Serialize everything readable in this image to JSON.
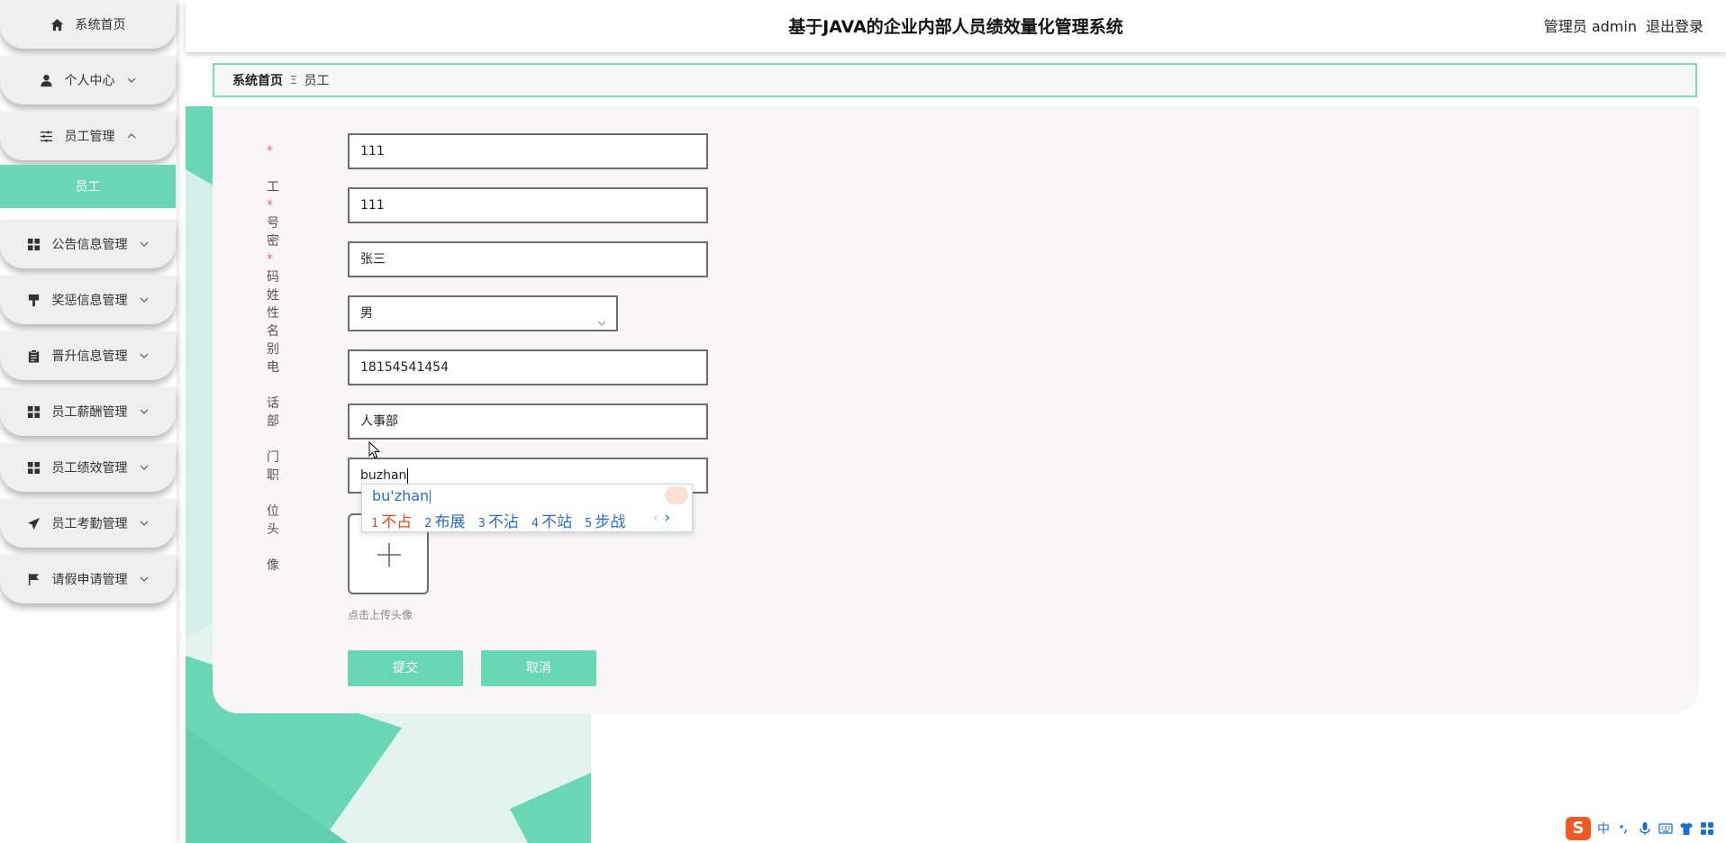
{
  "sidebar": {
    "items": [
      {
        "label": "系统首页",
        "icon": "home-icon",
        "chevron": ""
      },
      {
        "label": "个人中心",
        "icon": "user-icon",
        "chevron": "down"
      },
      {
        "label": "员工管理",
        "icon": "sliders-icon",
        "chevron": "up"
      },
      {
        "label": "公告信息管理",
        "icon": "grid-icon",
        "chevron": "down"
      },
      {
        "label": "奖惩信息管理",
        "icon": "brush-icon",
        "chevron": "down"
      },
      {
        "label": "晋升信息管理",
        "icon": "clipboard-icon",
        "chevron": "down"
      },
      {
        "label": "员工薪酬管理",
        "icon": "grid-icon",
        "chevron": "down"
      },
      {
        "label": "员工绩效管理",
        "icon": "grid-icon",
        "chevron": "down"
      },
      {
        "label": "员工考勤管理",
        "icon": "send-icon",
        "chevron": "down"
      },
      {
        "label": "请假申请管理",
        "icon": "flag-icon",
        "chevron": "down"
      }
    ],
    "submenu": {
      "label": "员工"
    }
  },
  "header": {
    "title": "基于JAVA的企业内部人员绩效量化管理系统",
    "role": "管理员 admin",
    "logout": "退出登录"
  },
  "breadcrumb": {
    "home": "系统首页",
    "separator": "Ξ",
    "current": "员工"
  },
  "form": {
    "fields": [
      {
        "label": "工号",
        "value": "111",
        "required": "*"
      },
      {
        "label": "密码",
        "value": "111",
        "required": "*"
      },
      {
        "label": "姓名",
        "value": "张三",
        "required": "*"
      },
      {
        "label": "性别",
        "value": "男",
        "required": ""
      },
      {
        "label": "电话",
        "value": "18154541454",
        "required": ""
      },
      {
        "label": "部门",
        "value": "人事部",
        "required": ""
      },
      {
        "label": "职位",
        "value": "buzhan",
        "required": ""
      }
    ],
    "avatar": {
      "label": "头像",
      "tip": "点击上传头像"
    },
    "submit": "提交",
    "cancel": "取消"
  },
  "ime": {
    "pinyin": "bu'zhan",
    "candidates": [
      {
        "num": "1",
        "text": "不占"
      },
      {
        "num": "2",
        "text": "布展"
      },
      {
        "num": "3",
        "text": "不沾"
      },
      {
        "num": "4",
        "text": "不站"
      },
      {
        "num": "5",
        "text": "步战"
      }
    ],
    "prev": "‹",
    "next": "›"
  },
  "tray": {
    "logo": "S",
    "lang": "中"
  },
  "colors": {
    "accent": "#69d6b4",
    "required": "#f56c6c",
    "ime_blue": "#2d6bc4",
    "ime_first": "#e04a1c"
  }
}
